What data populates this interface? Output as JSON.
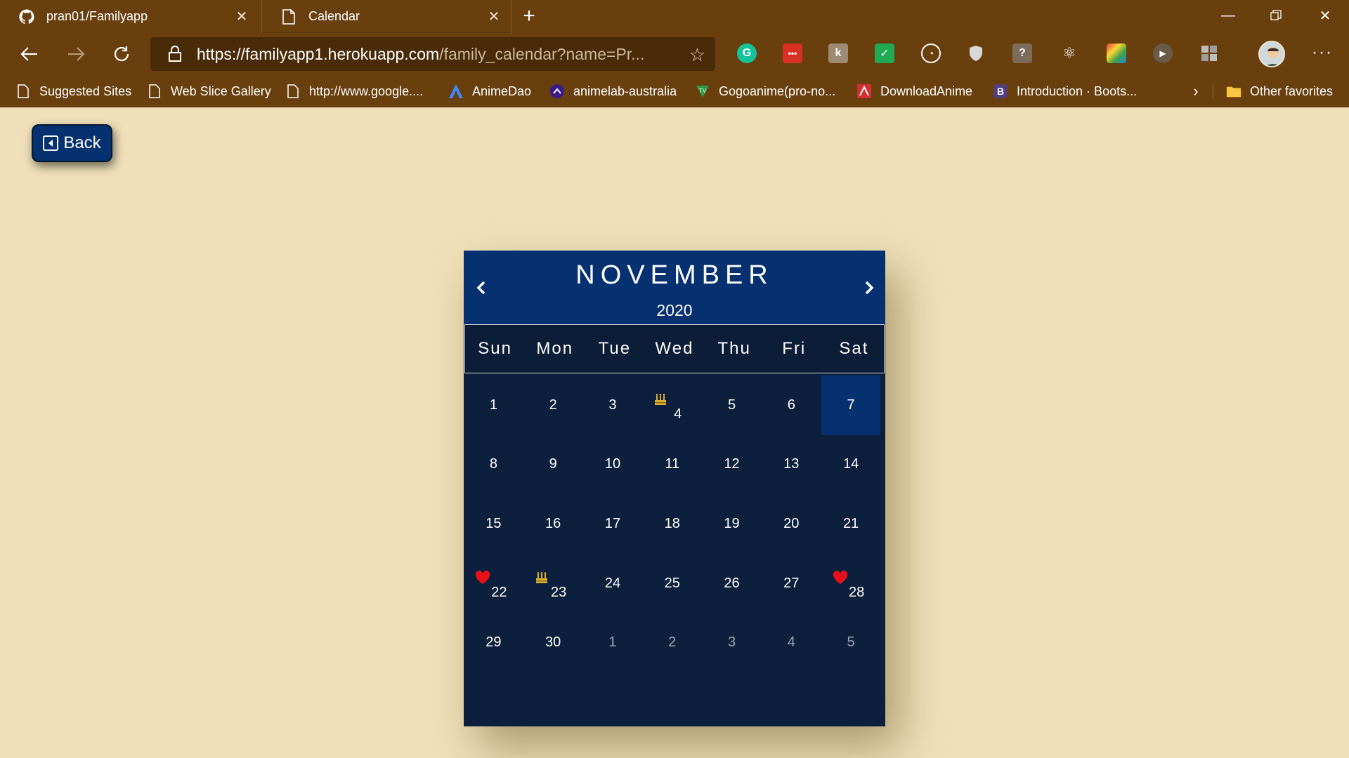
{
  "browser": {
    "tabs": [
      {
        "title": "pran01/Familyapp",
        "icon": "github-icon",
        "active": false
      },
      {
        "title": "Calendar",
        "icon": "page-icon",
        "active": true
      }
    ],
    "new_tab_label": "+",
    "url_main": "https://familyapp1.herokuapp.com",
    "url_rest": "/family_calendar?name=Pr...",
    "favorites": [
      {
        "label": "Suggested Sites",
        "icon": "page-icon"
      },
      {
        "label": "Web Slice Gallery",
        "icon": "page-icon"
      },
      {
        "label": "http://www.google....",
        "icon": "page-icon"
      },
      {
        "label": "AnimeDao",
        "icon": "animedao-icon"
      },
      {
        "label": "animelab-australia",
        "icon": "animelab-icon"
      },
      {
        "label": "Gogoanime(pro-no...",
        "icon": "gogoanime-icon"
      },
      {
        "label": "DownloadAnime",
        "icon": "downloadanime-icon"
      },
      {
        "label": "Introduction · Boots...",
        "icon": "bootstrap-icon"
      }
    ],
    "other_favorites": "Other favorites",
    "colors": {
      "chrome": "#6a3f0e",
      "omnibox": "#4a2b08"
    }
  },
  "page": {
    "back_label": "Back",
    "colors": {
      "background": "#efe0b9",
      "header": "#063170",
      "body": "#0c203d"
    }
  },
  "calendar": {
    "month": "NOVEMBER",
    "year": "2020",
    "weekdays": [
      "Sun",
      "Mon",
      "Tue",
      "Wed",
      "Thu",
      "Fri",
      "Sat"
    ],
    "weeks": [
      [
        {
          "d": "1"
        },
        {
          "d": "2"
        },
        {
          "d": "3"
        },
        {
          "d": "4",
          "event": "birthday-cake-icon"
        },
        {
          "d": "5"
        },
        {
          "d": "6"
        },
        {
          "d": "7",
          "selected": true
        }
      ],
      [
        {
          "d": "8"
        },
        {
          "d": "9"
        },
        {
          "d": "10"
        },
        {
          "d": "11"
        },
        {
          "d": "12"
        },
        {
          "d": "13"
        },
        {
          "d": "14"
        }
      ],
      [
        {
          "d": "15"
        },
        {
          "d": "16"
        },
        {
          "d": "17"
        },
        {
          "d": "18"
        },
        {
          "d": "19"
        },
        {
          "d": "20"
        },
        {
          "d": "21"
        }
      ],
      [
        {
          "d": "22",
          "event": "heart-icon"
        },
        {
          "d": "23",
          "event": "birthday-cake-icon"
        },
        {
          "d": "24"
        },
        {
          "d": "25"
        },
        {
          "d": "26"
        },
        {
          "d": "27"
        },
        {
          "d": "28",
          "event": "heart-icon"
        }
      ],
      [
        {
          "d": "29"
        },
        {
          "d": "30"
        },
        {
          "d": "1",
          "other": true
        },
        {
          "d": "2",
          "other": true
        },
        {
          "d": "3",
          "other": true
        },
        {
          "d": "4",
          "other": true
        },
        {
          "d": "5",
          "other": true
        }
      ]
    ]
  }
}
